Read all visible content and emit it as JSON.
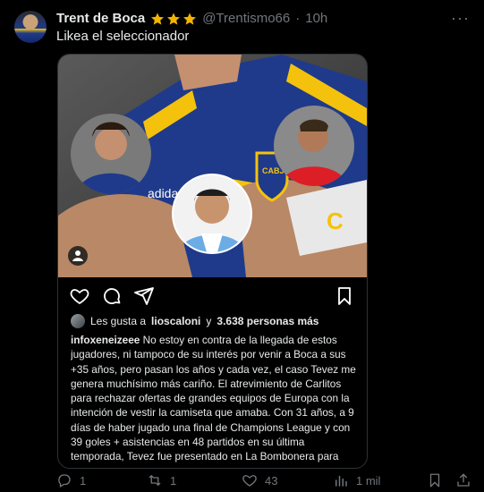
{
  "tweet": {
    "author_name": "Trent de Boca",
    "handle": "@Trentismo66",
    "separator": "·",
    "time": "10h",
    "text": "Likea el seleccionador",
    "more_label": "···"
  },
  "instagram": {
    "likes_prefix": "Les gusta a",
    "liker": "lioscaloni",
    "likes_mid": "y",
    "likes_count": "3.638 personas más",
    "caption_user": "infoxeneizeee",
    "caption_text": "No estoy en contra de la llegada de estos jugadores, ni tampoco de su interés por venir a Boca a sus +35 años, pero pasan los años y cada vez, el caso Tevez  me genera muchísimo más cariño. El atrevimiento de Carlitos para rechazar ofertas de grandes equipos de Europa con la intención de vestir la camiseta que amaba. Con 31 años, a 9 días de haber jugado una final de Champions League y con 39 goles + asistencias en 48 partidos en su última temporada, Tevez fue presentado en La Bombonera para iniciar su segunda etapa en el club. NO vino a retirarse. NADIE tuvo que"
  },
  "actions": {
    "replies": "1",
    "retweets": "1",
    "likes": "43",
    "views": "1 mil"
  },
  "colors": {
    "background": "#000000",
    "text": "#e7e9ea",
    "muted": "#71767b",
    "star": "#f4b400",
    "boca_blue": "#1f3a8a",
    "boca_gold": "#f4c20d"
  },
  "icons": [
    "verified-star-icon",
    "more-icon",
    "person-tag-icon",
    "heart-icon",
    "comment-icon",
    "send-icon",
    "bookmark-icon",
    "reply-icon",
    "retweet-icon",
    "like-icon",
    "views-icon",
    "share-icon"
  ]
}
